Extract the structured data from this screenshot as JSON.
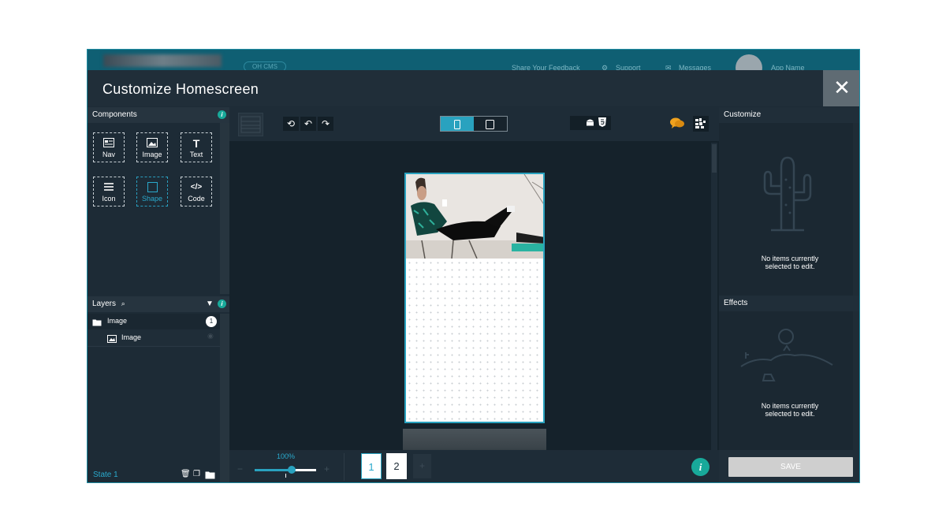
{
  "background_nav": {
    "cms_label": "OH CMS",
    "feedback": "Share Your Feedback",
    "support": "Support",
    "messages": "Messages",
    "app_name": "App Name"
  },
  "modal": {
    "title": "Customize Homescreen",
    "close_icon": "close-icon"
  },
  "components": {
    "header": "Components",
    "items": [
      {
        "label": "Nav",
        "icon": "nav-icon"
      },
      {
        "label": "Image",
        "icon": "image-icon"
      },
      {
        "label": "Text",
        "icon": "text-icon"
      },
      {
        "label": "Icon",
        "icon": "list-icon"
      },
      {
        "label": "Shape",
        "icon": "square-icon",
        "active": true
      },
      {
        "label": "Code",
        "icon": "code-icon"
      }
    ]
  },
  "layers": {
    "header": "Layers",
    "items": [
      {
        "label": "Image",
        "badge": "1",
        "icon": "folder-icon"
      },
      {
        "label": "Image",
        "icon": "image-icon"
      }
    ],
    "state_label": "State 1"
  },
  "toolbar": {
    "device_selected": "phone"
  },
  "zoom": {
    "value": "100%",
    "minus": "−",
    "plus": "+",
    "level": 0.6
  },
  "pages": {
    "items": [
      "1",
      "2"
    ],
    "add": "+",
    "selected": "1"
  },
  "customize": {
    "header": "Customize",
    "empty_text_line1": "No items currently",
    "empty_text_line2": "selected to edit."
  },
  "effects": {
    "header": "Effects",
    "empty_text_line1": "No items currently",
    "empty_text_line2": "selected to edit."
  },
  "save_button": "SAVE",
  "colors": {
    "accent": "#29a2bf",
    "teal_info": "#18a99a",
    "modal_bg": "#1d2b36",
    "chat_orange": "#f0a21e"
  }
}
